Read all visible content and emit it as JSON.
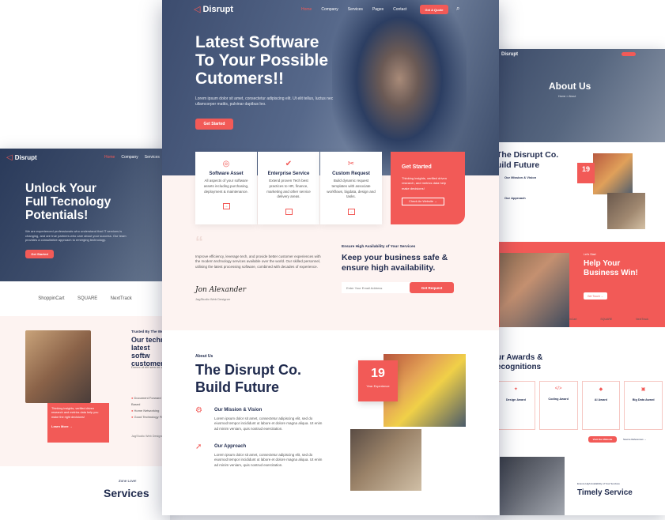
{
  "brand": {
    "name": "Disrupt",
    "accent": "#f25a57",
    "dark": "#1f2a4d"
  },
  "center": {
    "nav": [
      "Home",
      "Company",
      "Services",
      "Pages",
      "Contact"
    ],
    "get_quote": "Get A Quote",
    "hero_title_1": "Latest Software",
    "hero_title_2": "To Your Possible",
    "hero_title_3": "Cutomers!!",
    "hero_text": "Lorem ipsum dolor sit amet, consectetur adipiscing elit. Ut elit tellus, luctus nec ullamcorper mattis, pulvinar dapibus leo.",
    "hero_btn": "Get Started",
    "cards": [
      {
        "icon": "◎",
        "title": "Software Asset",
        "text": "All aspects of your software assets including purchasing, deployment & maintenance."
      },
      {
        "icon": "✔",
        "title": "Enterprise Service",
        "text": "Extend proven Tech best practices to HR, finance, marketing and other service delivery areas."
      },
      {
        "icon": "✂",
        "title": "Custom Request",
        "text": "Build dynamic request templates with associate workflows, bigdata, design and tasks."
      }
    ],
    "get_started": {
      "title": "Get Started",
      "text": "Thinking insights, verified driven research, and metrics data help make decisions!",
      "btn": "Check An Website →"
    },
    "quote_text": "Improve efficiency, leverage tech, and provide better customer experiences with the modern technology services available over the world. Our skilled personnel, utilising the latest processing software, combined with decades of experience.",
    "signature": "Jon Alexander",
    "signature_role": "JagStudio Web Designer",
    "avail_label": "Ensure High Availability of Your Services",
    "avail_title_1": "Keep your business safe &",
    "avail_title_2": "ensure high availability.",
    "email_placeholder": "Enter Your Email Address",
    "request_btn": "Get Request",
    "about_label": "About Us",
    "about_title_1": "The Disrupt Co.",
    "about_title_2": "Build Future",
    "mission_title": "Our Mission & Vision",
    "mission_text": "Lorem ipsum dolor sit amet, consectetur adipiscing elit, sed do eiusmod tempor incididunt ut labore et dolore magna aliqua. Ut enim ad minim veniam, quis nostrud exercitation.",
    "approach_title": "Our Approach",
    "approach_text": "Lorem ipsum dolor sit amet, consectetur adipiscing elit, sed do eiusmod tempor incididunt ut labore et dolore magna aliqua. Ut enim ad minim veniam, quis nostrud exercitation.",
    "years": "19",
    "years_label": "Year Experience"
  },
  "left": {
    "title_1": "Unlock Your",
    "title_2": "Full Tecnology",
    "title_3": "Potentials!",
    "text": "We are experienced professionals who understand that IT services is changing, and are true partners who care about your success. Our team provides a consultative approach to emerging technology.",
    "btn": "Get Started",
    "nav": [
      "Home",
      "Company",
      "Services"
    ],
    "logos": [
      "ShoppinCart",
      "SQUARE",
      "NextTrack"
    ],
    "trusted": "Trusted By The World",
    "tech_1": "Our techno",
    "tech_2": "latest softw",
    "tech_3": "customers!",
    "text2": "Donec ut elit sem mi vel",
    "checks": [
      "Document Forward Based",
      "Home Networking",
      "Good Technology Fix"
    ],
    "promo": "Thinking insights, verified driven research and metrics data help you make the right decisions!",
    "learn": "Learn More →",
    "sign_role": "JagStudio Web Designer",
    "services_label": "Zone Love!",
    "services_title": "Services"
  },
  "right": {
    "about_title": "About Us",
    "about_crumb": "Home > About",
    "co_1": "The Disrupt Co.",
    "co_2": "uild Future",
    "years": "19",
    "mission": "Our Mission & Vision",
    "approach": "Our Approach",
    "help_label": "Let's Start",
    "help_1": "Help Your",
    "help_2": "Business Win!",
    "help_btn": "Get Touch →",
    "logos": [
      "ShoppinCart",
      "SQUARE",
      "NextTrack"
    ],
    "awards_1": "ur Awards &",
    "awards_2": "ecognitions",
    "awards": [
      {
        "icon": "✦",
        "title": "Design Award"
      },
      {
        "icon": "</>",
        "title": "Coding Award"
      },
      {
        "icon": "◆",
        "title": "AI Award"
      },
      {
        "icon": "▣",
        "title": "Big Data Award"
      }
    ],
    "award_btn": "Visit Our Website",
    "award_link": "Source References →",
    "timely_label": "Ensure High Availability of Your Services",
    "timely": "Timely Service"
  }
}
